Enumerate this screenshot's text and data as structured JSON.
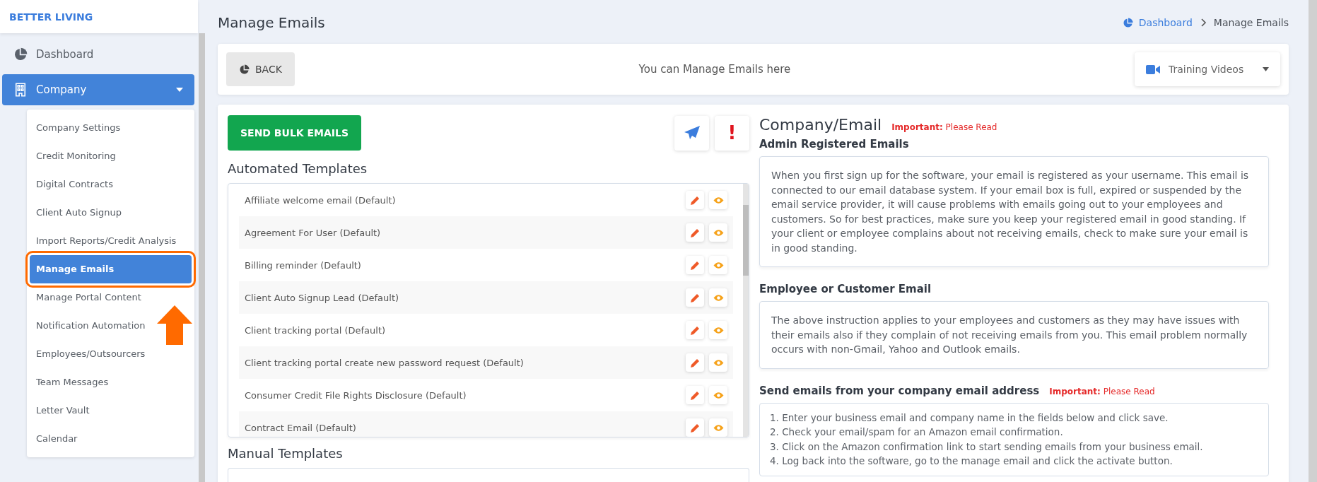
{
  "sidebar": {
    "brand": "BETTER LIVING",
    "items": [
      {
        "label": "Dashboard",
        "selected": false
      },
      {
        "label": "Company",
        "selected": true,
        "expanded": true,
        "children": [
          {
            "label": "Company Settings",
            "selected": false
          },
          {
            "label": "Credit Monitoring",
            "selected": false
          },
          {
            "label": "Digital Contracts",
            "selected": false
          },
          {
            "label": "Client Auto Signup",
            "selected": false
          },
          {
            "label": "Import Reports/Credit Analysis",
            "selected": false
          },
          {
            "label": "Manage Emails",
            "selected": true
          },
          {
            "label": "Manage Portal Content",
            "selected": false
          },
          {
            "label": "Notification Automation",
            "selected": false
          },
          {
            "label": "Employees/Outsourcers",
            "selected": false
          },
          {
            "label": "Team Messages",
            "selected": false
          },
          {
            "label": "Letter Vault",
            "selected": false
          },
          {
            "label": "Calendar",
            "selected": false
          }
        ]
      }
    ]
  },
  "page": {
    "title": "Manage Emails",
    "breadcrumb": [
      {
        "label": "Dashboard"
      },
      {
        "label": "Manage Emails"
      }
    ]
  },
  "toolbar": {
    "back": "BACK",
    "message": "You can Manage Emails here",
    "training": "Training Videos"
  },
  "actions": {
    "bulk": "SEND BULK EMAILS",
    "alert": "!"
  },
  "automated": {
    "title": "Automated Templates",
    "rows": [
      {
        "name": "Affiliate welcome email (Default)"
      },
      {
        "name": "Agreement For User (Default)"
      },
      {
        "name": "Billing reminder (Default)"
      },
      {
        "name": "Client Auto Signup Lead (Default)"
      },
      {
        "name": "Client tracking portal (Default)"
      },
      {
        "name": "Client tracking portal create new password request (Default)"
      },
      {
        "name": "Consumer Credit File Rights Disclosure (Default)"
      },
      {
        "name": "Contract Email (Default)"
      }
    ]
  },
  "manual": {
    "title": "Manual Templates"
  },
  "info": {
    "title": "Company/Email",
    "notice": "**Important:** Please Read",
    "sections": [
      {
        "heading": "Admin Registered Emails",
        "kind": "paragraph",
        "text": "When you first sign up for the software, your email is registered as your username. This email is connected to our email database system. If your email box is full, expired or suspended by the email service provider, it will cause problems with emails going out to your employees and customers. So for best practices, make sure you keep your registered email in good standing. If your client or employee complains about not receiving emails, check to make sure your email is in good standing."
      },
      {
        "heading": "Employee or Customer Email",
        "kind": "paragraph",
        "text": "The above instruction applies to your employees and customers as they may have issues with their emails also if they complain of not receiving emails from you. This email problem normally occurs with non-Gmail, Yahoo and Outlook emails."
      },
      {
        "heading": "Send emails from your company email address",
        "notice": "**Important:** Please Read",
        "kind": "list",
        "items": [
          "1. Enter your business email and company name in the fields below and click save.",
          "2. Check your email/spam for an Amazon email confirmation.",
          "3. Click on the Amazon confirmation link to start sending emails from your business email.",
          "4. Log back into the software, go to the manage email and click the activate button."
        ]
      }
    ]
  }
}
